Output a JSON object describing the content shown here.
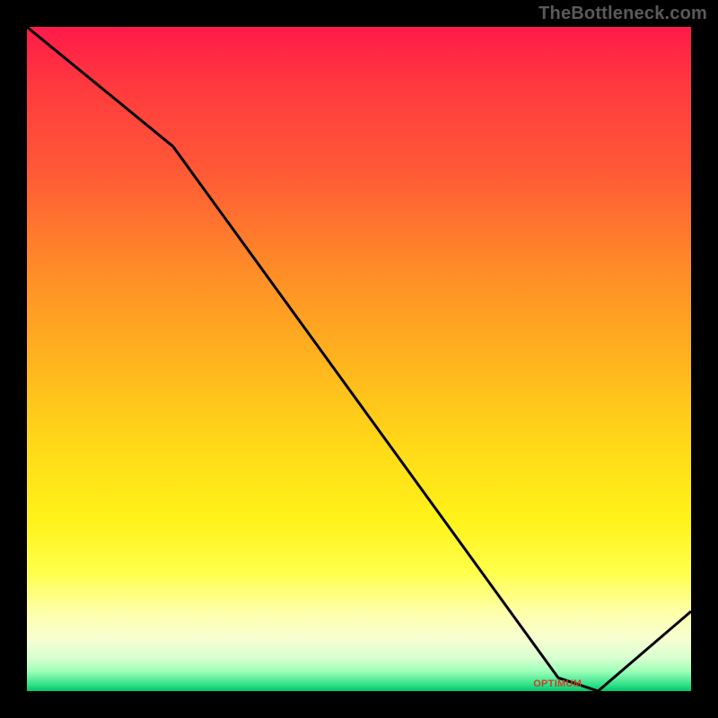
{
  "attribution": "TheBottleneck.com",
  "min_label": "OPTIMUM",
  "chart_data": {
    "type": "line",
    "title": "",
    "xlabel": "",
    "ylabel": "",
    "xlim": [
      0,
      100
    ],
    "ylim": [
      0,
      100
    ],
    "series": [
      {
        "name": "bottleneck-curve",
        "x": [
          0,
          22,
          80,
          86,
          100
        ],
        "y": [
          100,
          82,
          2,
          0,
          12
        ]
      }
    ],
    "min_point": {
      "x": 83,
      "y": 0
    },
    "grid": false,
    "legend": false
  },
  "colors": {
    "curve": "#000000",
    "min_label": "#d23c2a"
  }
}
